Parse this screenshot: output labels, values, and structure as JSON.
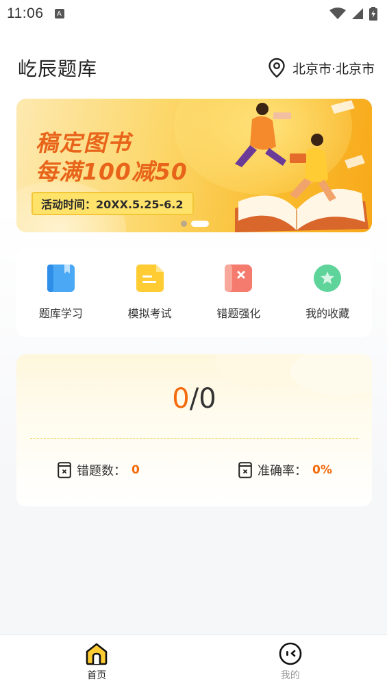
{
  "status_bar": {
    "time": "11:06",
    "notification_icon_letter": "A"
  },
  "header": {
    "title": "屹辰题库",
    "location": "北京市·北京市"
  },
  "banner": {
    "line1": "稿定图书",
    "line2": "每满100减50",
    "tag": "活动时间：20XX.5.25-6.2",
    "slide_count": 2,
    "active_slide": 2
  },
  "menu": [
    {
      "label": "题库学习",
      "icon": "book-icon",
      "color": "#4aa8f5"
    },
    {
      "label": "模拟考试",
      "icon": "exam-icon",
      "color": "#ffcc33"
    },
    {
      "label": "错题强化",
      "icon": "wrong-book-icon",
      "color": "#f57b6e"
    },
    {
      "label": "我的收藏",
      "icon": "star-icon",
      "color": "#5ed39a"
    }
  ],
  "stats": {
    "correct": "0",
    "separator": "/",
    "total": "0",
    "wrong_label": "错题数：",
    "wrong_value": "0",
    "accuracy_label": "准确率：",
    "accuracy_value": "0%"
  },
  "nav": [
    {
      "label": "首页",
      "icon": "home-icon",
      "active": true
    },
    {
      "label": "我的",
      "icon": "profile-icon",
      "active": false
    }
  ],
  "colors": {
    "accent": "#f46a0c",
    "brand_yellow": "#ffcc33",
    "nav_active": "#222222",
    "nav_inactive": "#999999"
  }
}
